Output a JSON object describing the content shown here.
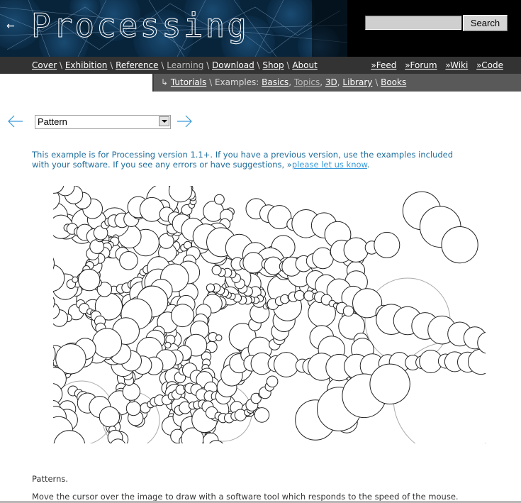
{
  "header": {
    "logo": "Processing",
    "back_icon": "left-arrow-icon",
    "back_glyph": "←",
    "search": {
      "placeholder": "",
      "value": "",
      "button_label": "Search"
    }
  },
  "nav": {
    "primary": [
      {
        "label": "Cover",
        "active": false
      },
      {
        "label": "Exhibition",
        "active": false
      },
      {
        "label": "Reference",
        "active": false
      },
      {
        "label": "Learning",
        "active": true
      },
      {
        "label": "Download",
        "active": false
      },
      {
        "label": "Shop",
        "active": false
      },
      {
        "label": "About",
        "active": false
      }
    ],
    "separator": "\\",
    "feeds": [
      {
        "label": "»Feed"
      },
      {
        "label": "»Forum"
      },
      {
        "label": "»Wiki"
      },
      {
        "label": "»Code"
      }
    ]
  },
  "subnav": {
    "arrow_glyph": "↳",
    "tutorials": "Tutorials",
    "examples_label": "Examples:",
    "basics": "Basics",
    "topics": "Topics",
    "three_d": "3D",
    "library": "Library",
    "books": "Books"
  },
  "example_nav": {
    "prev_icon": "prev-arrow-icon",
    "next_icon": "next-arrow-icon",
    "selected": "Pattern"
  },
  "version_note": {
    "text": "This example is for Processing version 1.1+. If you have a previous version, use the examples included with your software. If you see any errors or have suggestions, »",
    "link": "please let us know",
    "end": "."
  },
  "description": {
    "title": "Patterns.",
    "body": "Move the cursor over the image to draw with a software tool which responds to the speed of the mouse."
  },
  "colors": {
    "header_bg": "#000000",
    "nav_bg": "#333333",
    "subnav_bg": "#595959",
    "note_text": "#1f6e9c",
    "link_blue": "#3a9ad9",
    "arrow_blue": "#3a9ad9"
  }
}
